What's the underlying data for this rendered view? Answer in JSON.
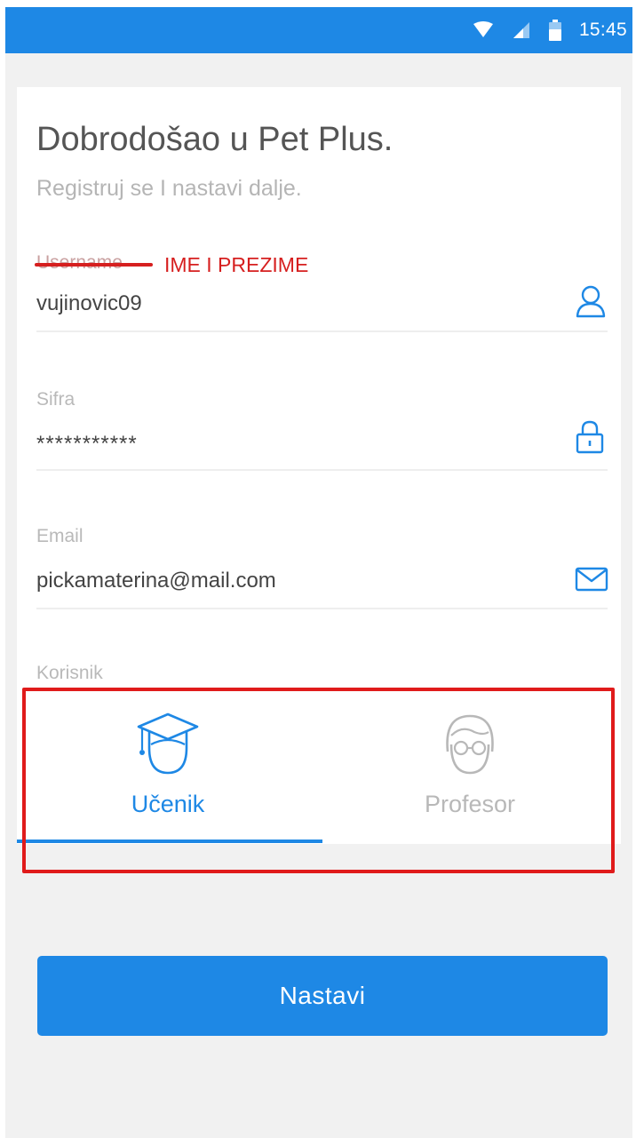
{
  "status_bar": {
    "time": "15:45",
    "icons": [
      "wifi-icon",
      "signal-icon",
      "battery-icon"
    ]
  },
  "form": {
    "title": "Dobrodošao u Pet Plus.",
    "subtitle": "Registruj se I nastavi dalje.",
    "username": {
      "label": "Username",
      "value": "vujinovic09",
      "icon": "user-icon"
    },
    "password": {
      "label": "Sifra",
      "value": "***********",
      "icon": "lock-icon"
    },
    "email": {
      "label": "Email",
      "value": "pickamaterina@mail.com",
      "icon": "mail-icon"
    },
    "user_type": {
      "label": "Korisnik",
      "options": [
        {
          "label": "Učenik",
          "icon": "graduation-cap-icon",
          "selected": true
        },
        {
          "label": "Profesor",
          "icon": "professor-glasses-icon",
          "selected": false
        }
      ]
    }
  },
  "annotations": {
    "username_replacement": "IME I PREZIME",
    "color": "#d61f1f"
  },
  "actions": {
    "continue_label": "Nastavi"
  },
  "colors": {
    "accent": "#1e88e5",
    "background": "#f1f1f1",
    "card": "#ffffff"
  }
}
